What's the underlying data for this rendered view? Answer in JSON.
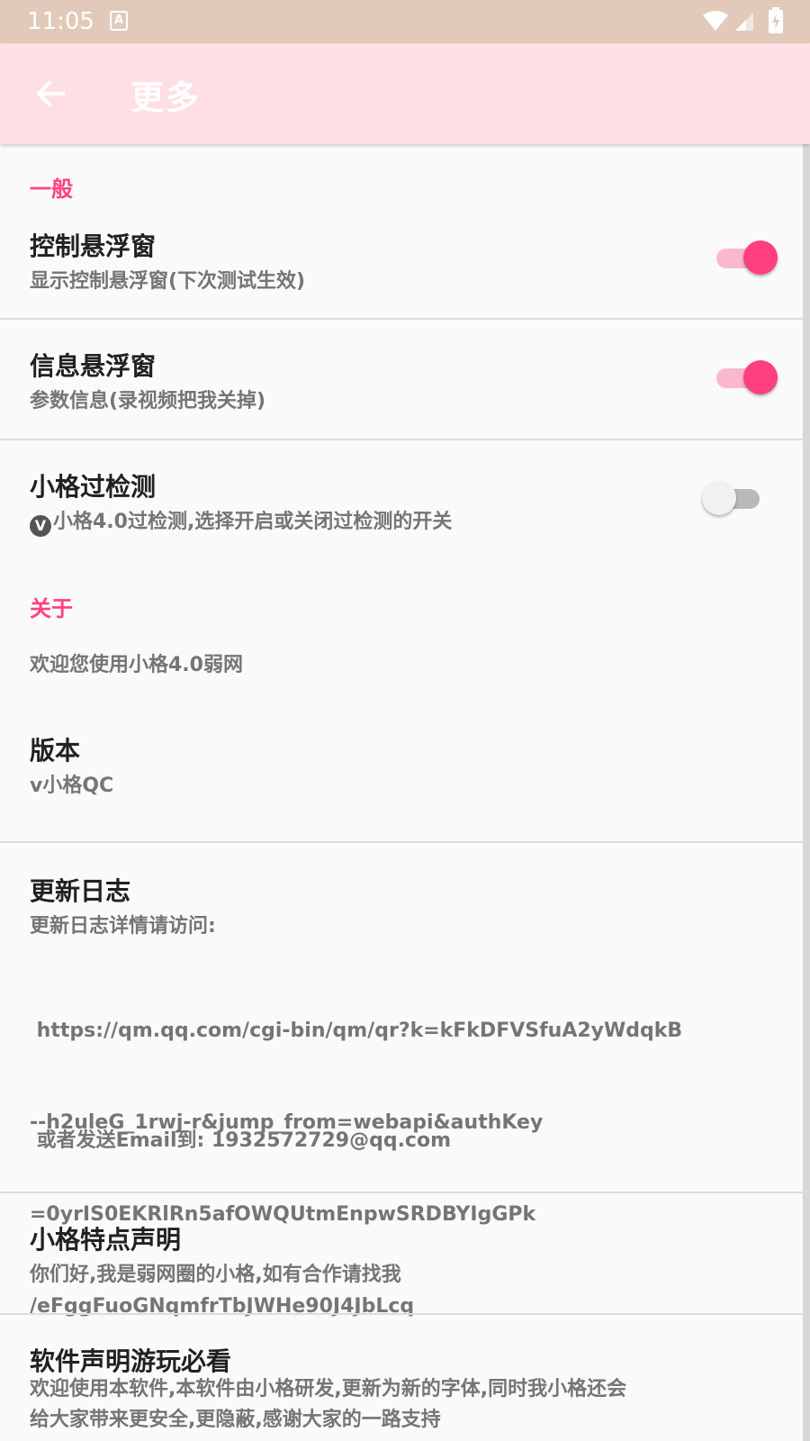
{
  "status_bar": {
    "time": "11:05",
    "notification_icon": "A",
    "icons": [
      "wifi-icon",
      "signal-icon",
      "battery-charging-icon"
    ]
  },
  "app_bar": {
    "back_icon": "arrow-back-icon",
    "title": "更多"
  },
  "sections": {
    "general": {
      "header": "一般",
      "items": [
        {
          "title": "控制悬浮窗",
          "summary": "显示控制悬浮窗(下次测试生效)",
          "switch_on": true
        },
        {
          "title": "信息悬浮窗",
          "summary": "参数信息(录视频把我关掉)",
          "switch_on": true
        },
        {
          "title": "小格过检测",
          "badge": "V",
          "summary": "小格4.0过检测,选择开启或关闭过检测的开关",
          "switch_on": false
        }
      ]
    },
    "about": {
      "header": "关于",
      "welcome": "欢迎您使用小格4.0弱网",
      "version": {
        "title": "版本",
        "summary": "v小格QC"
      },
      "changelog": {
        "title": "更新日志",
        "line1": "更新日志详情请访问:",
        "url_lines": [
          " https://qm.qq.com/cgi-bin/qm/qr?k=kFkDFVSfuA2yWdqkB",
          "--h2uleG_1rwj-r&jump_from=webapi&authKey",
          "=0yrIS0EKRlRn5afOWQUtmEnpwSRDBYIgGPk",
          "/eFggFuoGNqmfrTbJWHe90J4JbLcq"
        ],
        "email_line": " 或者发送Email到: 1932572729@qq.com"
      },
      "feature": {
        "title": "小格特点声明",
        "summary": "你们好,我是弱网圈的小格,如有合作请找我"
      },
      "statement": {
        "title": "软件声明游玩必看",
        "lines": [
          "欢迎使用本软件,本软件由小格研发,更新为新的字体,同时我小格还会",
          "给大家带来更安全,更隐蔽,感谢大家的一路支持"
        ]
      }
    }
  },
  "colors": {
    "status_bar": "#e2cabb",
    "app_bar": "#ffdfe4",
    "accent": "#ff4081",
    "switch_thumb_on": "#ff3f7f",
    "switch_track_on": "#f9b8cd"
  }
}
